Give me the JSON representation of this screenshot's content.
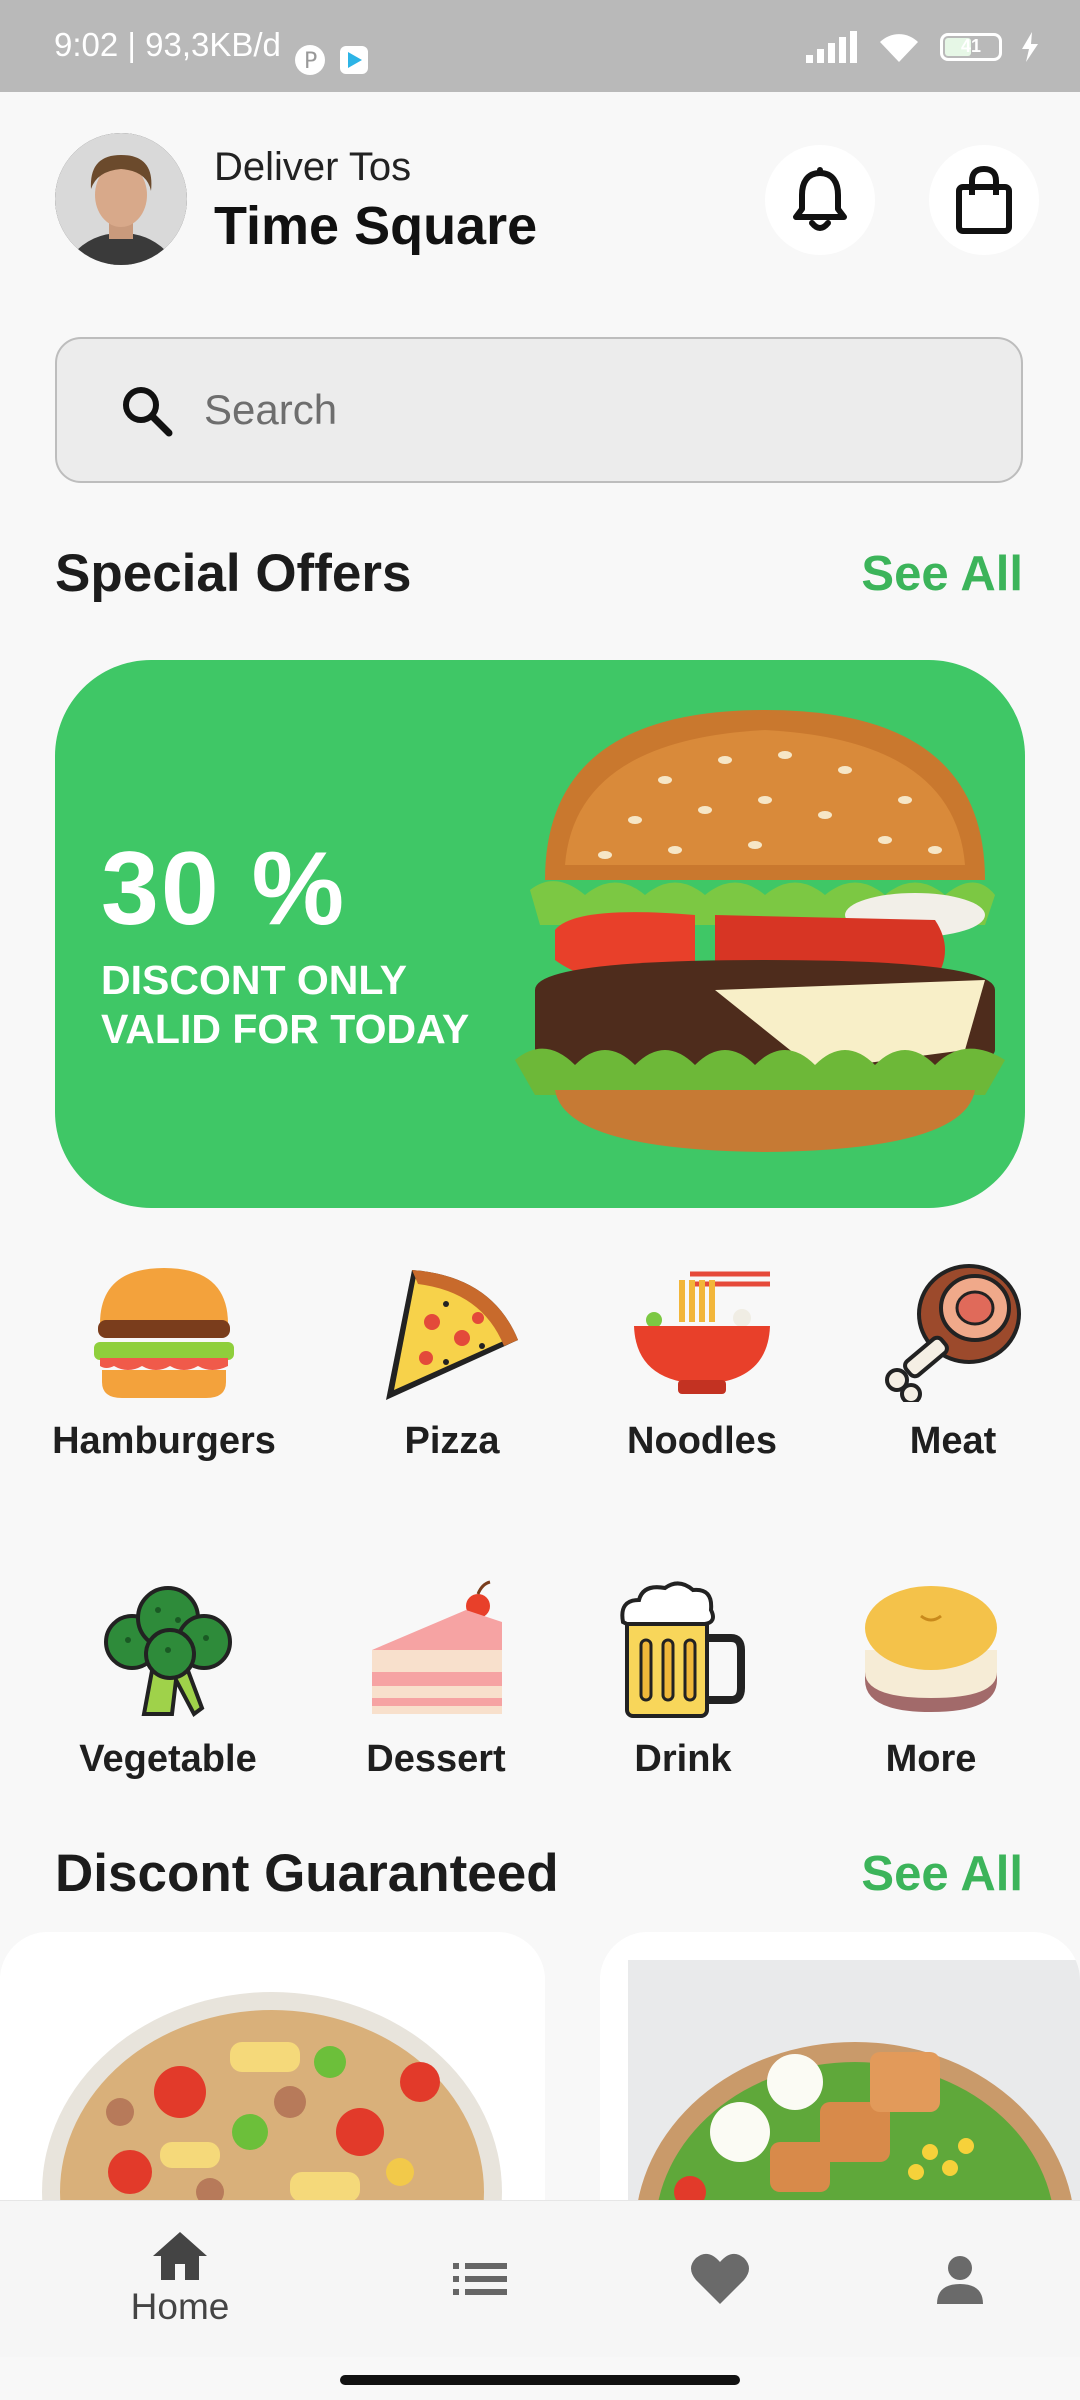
{
  "status_bar": {
    "time": "9:02 | 93,3KB/d",
    "battery": "41"
  },
  "header": {
    "deliver_label": "Deliver Tos",
    "location": "Time Square",
    "icons": [
      "bell-icon",
      "shopping-bag-icon"
    ]
  },
  "search": {
    "placeholder": "Search"
  },
  "special_offers": {
    "title": "Special Offers",
    "see_all": "See All",
    "banner": {
      "percent": "30 %",
      "line1": "DISCONT ONLY",
      "line2": "VALID FOR TODAY"
    }
  },
  "categories": [
    {
      "label": "Hamburgers",
      "icon": "hamburger-icon"
    },
    {
      "label": "Pizza",
      "icon": "pizza-icon"
    },
    {
      "label": "Noodles",
      "icon": "noodles-icon"
    },
    {
      "label": "Meat",
      "icon": "meat-icon"
    },
    {
      "label": "Vegetable",
      "icon": "broccoli-icon"
    },
    {
      "label": "Dessert",
      "icon": "cake-icon"
    },
    {
      "label": "Drink",
      "icon": "beer-icon"
    },
    {
      "label": "More",
      "icon": "more-icon"
    }
  ],
  "discount": {
    "title": "Discont Guaranteed",
    "see_all": "See All"
  },
  "bottom_nav": [
    {
      "label": "Home",
      "icon": "home-icon",
      "active": true
    },
    {
      "icon": "list-icon"
    },
    {
      "icon": "heart-icon"
    },
    {
      "icon": "profile-icon"
    }
  ],
  "colors": {
    "accent": "#3cb45a",
    "banner": "#3fc766"
  }
}
